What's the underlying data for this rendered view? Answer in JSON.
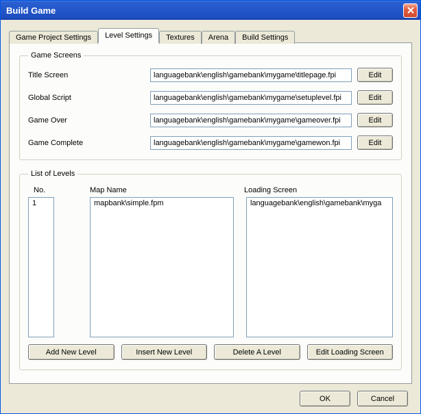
{
  "window": {
    "title": "Build Game"
  },
  "tabs": [
    {
      "label": "Game Project Settings"
    },
    {
      "label": "Level Settings"
    },
    {
      "label": "Textures"
    },
    {
      "label": "Arena"
    },
    {
      "label": "Build Settings"
    }
  ],
  "gameScreens": {
    "legend": "Game Screens",
    "rows": {
      "titleScreen": {
        "label": "Title Screen",
        "value": "languagebank\\english\\gamebank\\mygame\\titlepage.fpi",
        "edit": "Edit"
      },
      "globalScript": {
        "label": "Global Script",
        "value": "languagebank\\english\\gamebank\\mygame\\setuplevel.fpi",
        "edit": "Edit"
      },
      "gameOver": {
        "label": "Game Over",
        "value": "languagebank\\english\\gamebank\\mygame\\gameover.fpi",
        "edit": "Edit"
      },
      "gameComplete": {
        "label": "Game Complete",
        "value": "languagebank\\english\\gamebank\\mygame\\gamewon.fpi",
        "edit": "Edit"
      }
    }
  },
  "levels": {
    "legend": "List of Levels",
    "headers": {
      "no": "No.",
      "map": "Map Name",
      "load": "Loading Screen"
    },
    "items": [
      {
        "no": "1",
        "map": "mapbank\\simple.fpm",
        "load": "languagebank\\english\\gamebank\\myga"
      }
    ],
    "buttons": {
      "add": "Add New Level",
      "insert": "Insert New Level",
      "delete": "Delete A Level",
      "editLoad": "Edit Loading Screen"
    }
  },
  "footer": {
    "ok": "OK",
    "cancel": "Cancel"
  }
}
